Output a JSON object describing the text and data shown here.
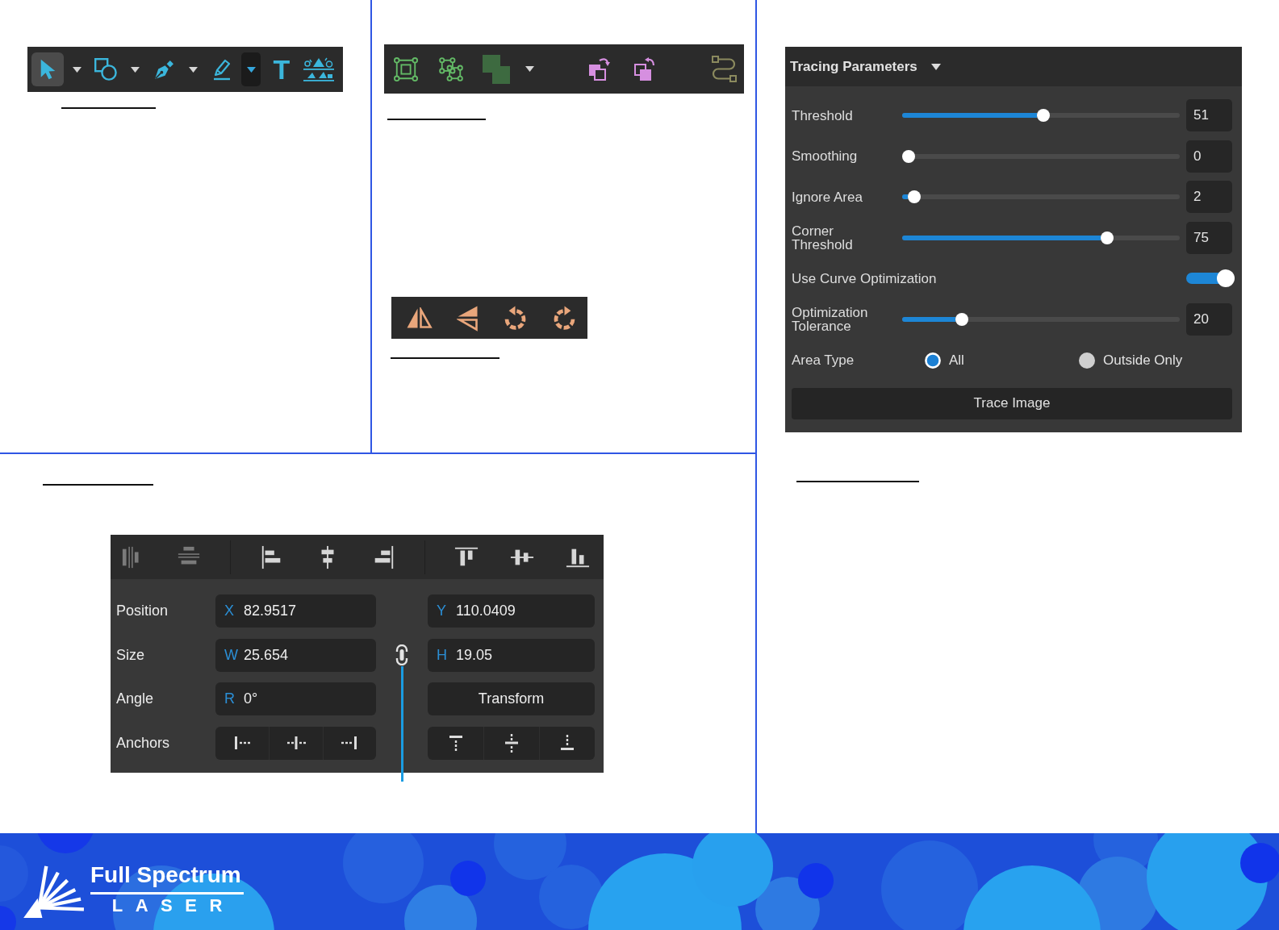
{
  "drawing_toolbar": {
    "items": [
      {
        "kind": "tool",
        "selected": true
      },
      {
        "kind": "caret",
        "selected": false
      },
      {
        "kind": "tool",
        "selected": false
      },
      {
        "kind": "caret",
        "selected": false
      },
      {
        "kind": "tool",
        "selected": false
      },
      {
        "kind": "caret",
        "selected": false
      },
      {
        "kind": "tool",
        "selected": false
      },
      {
        "kind": "caret",
        "selected": true
      },
      {
        "kind": "glyph",
        "text": "T",
        "selected": false
      },
      {
        "kind": "tool",
        "selected": false
      }
    ]
  },
  "arrange_toolbar": {
    "items": [
      {
        "kind": "tool"
      },
      {
        "kind": "tool"
      },
      {
        "kind": "tool"
      },
      {
        "kind": "caret"
      },
      {
        "kind": "tool"
      },
      {
        "kind": "tool"
      },
      {
        "kind": "tool"
      }
    ]
  },
  "tracing_panel": {
    "title": "Tracing Parameters",
    "expanded": true,
    "rows": [
      {
        "kind": "slider",
        "label": "Threshold",
        "level": 0.51,
        "value": "51"
      },
      {
        "kind": "slider",
        "label": "Smoothing",
        "level": 0,
        "value": "0"
      },
      {
        "kind": "slider",
        "label": "Ignore Area",
        "level": 0.02,
        "value": "2"
      },
      {
        "kind": "slider",
        "label": "Corner Threshold",
        "level": 0.75,
        "value": "75"
      },
      {
        "kind": "toggle",
        "label": "Use Curve Optimization",
        "on": true
      },
      {
        "kind": "slider",
        "label": "Optimization Tolerance",
        "level": 0.2,
        "value": "20"
      },
      {
        "kind": "radio",
        "label": "Area Type",
        "options": [
          {
            "label": "All",
            "selected": true
          },
          {
            "label": "Outside Only",
            "selected": false
          }
        ]
      }
    ],
    "button": "Trace Image"
  },
  "mirror_toolbar": {
    "items": [
      {
        "kind": "tool"
      },
      {
        "kind": "tool"
      },
      {
        "kind": "tool"
      },
      {
        "kind": "tool"
      }
    ]
  },
  "transform_panel": {
    "align_groups": [
      [
        {
          "disabled": true
        },
        {
          "disabled": true
        }
      ],
      [
        {
          "disabled": false
        },
        {
          "disabled": false
        },
        {
          "disabled": false
        }
      ],
      [
        {
          "disabled": false
        },
        {
          "disabled": false
        },
        {
          "disabled": false
        }
      ]
    ],
    "rows": [
      {
        "kind": "fields",
        "label": "Position",
        "left": {
          "prefix": "X",
          "value": "82.9517"
        },
        "right": {
          "kind": "field",
          "prefix": "Y",
          "value": "110.0409"
        }
      },
      {
        "kind": "fields",
        "label": "Size",
        "left": {
          "prefix": "W",
          "value": "25.654"
        },
        "link_toggle": true,
        "right": {
          "kind": "field",
          "prefix": "H",
          "value": "19.05"
        }
      },
      {
        "kind": "fields",
        "label": "Angle",
        "left": {
          "prefix": "R",
          "value": "0°"
        },
        "right": {
          "kind": "button",
          "label": "Transform"
        }
      },
      {
        "kind": "anchors",
        "label": "Anchors"
      }
    ],
    "leader_line": true
  },
  "footer": {
    "brand": "Full Spectrum",
    "tagline": "LASER"
  }
}
